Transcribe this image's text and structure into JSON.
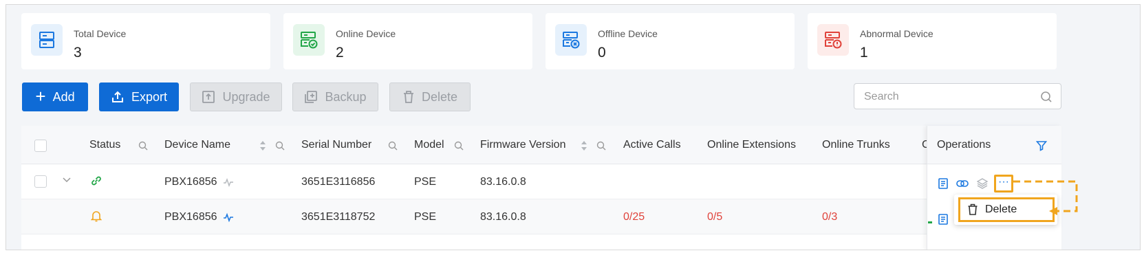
{
  "stats": [
    {
      "label": "Total Device",
      "value": "3",
      "icon": "server-icon",
      "color": "#1b78e0"
    },
    {
      "label": "Online Device",
      "value": "2",
      "icon": "server-check-icon",
      "color": "#22a648"
    },
    {
      "label": "Offline Device",
      "value": "0",
      "icon": "server-x-icon",
      "color": "#1b78e0"
    },
    {
      "label": "Abnormal Device",
      "value": "1",
      "icon": "server-alert-icon",
      "color": "#e0423a"
    }
  ],
  "toolbar": {
    "add": "Add",
    "export": "Export",
    "upgrade": "Upgrade",
    "backup": "Backup",
    "delete": "Delete",
    "search_placeholder": "Search"
  },
  "table": {
    "headers": {
      "status": "Status",
      "device_name": "Device Name",
      "serial": "Serial Number",
      "model": "Model",
      "firmware": "Firmware Version",
      "active_calls": "Active Calls",
      "online_ext": "Online Extensions",
      "online_trunks": "Online Trunks",
      "cut": "C",
      "operations": "Operations"
    },
    "rows": [
      {
        "status_icon": "link-icon",
        "device_name": "PBX16856",
        "serial": "3651E3116856",
        "model": "PSE",
        "firmware": "83.16.0.8",
        "active_calls": "",
        "online_ext": "",
        "online_trunks": ""
      },
      {
        "status_icon": "bell-icon",
        "device_name": "PBX16856",
        "serial": "3651E3118752",
        "model": "PSE",
        "firmware": "83.16.0.8",
        "active_calls": "0/25",
        "online_ext": "0/5",
        "online_trunks": "0/3"
      }
    ]
  },
  "dropdown": {
    "delete": "Delete"
  },
  "colors": {
    "primary": "#0f6bd6",
    "highlight": "#f0a51e",
    "error": "#e0423a",
    "success": "#22a648"
  }
}
